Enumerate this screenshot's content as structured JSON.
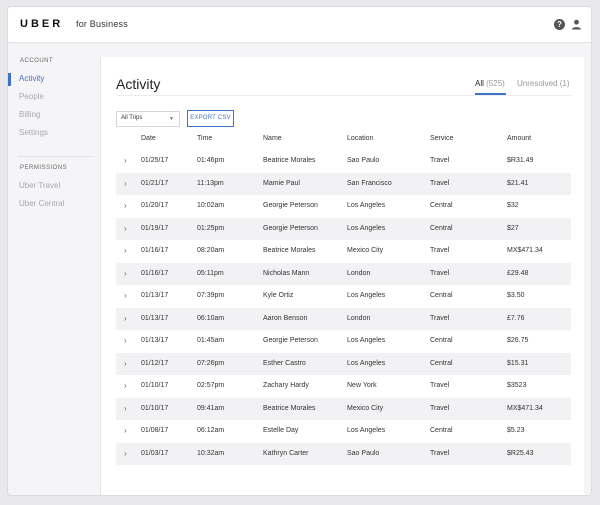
{
  "header": {
    "logo": "UBER",
    "logo_suffix": "for Business",
    "help_icon": "?",
    "icons": [
      "help-icon",
      "user-icon"
    ]
  },
  "sidebar": {
    "account_heading": "ACCOUNT",
    "account_items": [
      {
        "label": "Activity",
        "active": true
      },
      {
        "label": "People",
        "active": false
      },
      {
        "label": "Billing",
        "active": false
      },
      {
        "label": "Settings",
        "active": false
      }
    ],
    "permissions_heading": "PERMISSIONS",
    "permissions_items": [
      {
        "label": "Uber Travel"
      },
      {
        "label": "Uber Central"
      }
    ]
  },
  "main": {
    "title": "Activity",
    "tabs": [
      {
        "label": "All",
        "count": "(525)",
        "active": true
      },
      {
        "label": "Unresolved",
        "count": "(1)",
        "active": false
      }
    ],
    "filter": {
      "selected": "All Trips"
    },
    "export_label": "EXPORT CSV"
  },
  "table": {
    "columns": [
      "Date",
      "Time",
      "Name",
      "Location",
      "Service",
      "Amount"
    ],
    "rows": [
      {
        "date": "01/25/17",
        "time": "01:46pm",
        "name": "Beatrice Morales",
        "location": "Sao Paulo",
        "service": "Travel",
        "amount": "$R31.49"
      },
      {
        "date": "01/21/17",
        "time": "11:13pm",
        "name": "Mamie Paul",
        "location": "San Francisco",
        "service": "Travel",
        "amount": "$21.41"
      },
      {
        "date": "01/20/17",
        "time": "10:02am",
        "name": "Georgie Peterson",
        "location": "Los Angeles",
        "service": "Central",
        "amount": "$32"
      },
      {
        "date": "01/19/17",
        "time": "01:25pm",
        "name": "Georgie Peterson",
        "location": "Los Angeles",
        "service": "Central",
        "amount": "$27"
      },
      {
        "date": "01/16/17",
        "time": "08:20am",
        "name": "Beatrice Morales",
        "location": "Mexico City",
        "service": "Travel",
        "amount": "MX$471.34"
      },
      {
        "date": "01/16/17",
        "time": "05:11pm",
        "name": "Nicholas Mann",
        "location": "London",
        "service": "Travel",
        "amount": "£29.48"
      },
      {
        "date": "01/13/17",
        "time": "07:39pm",
        "name": "Kyle Ortiz",
        "location": "Los Angeles",
        "service": "Central",
        "amount": "$3.50"
      },
      {
        "date": "01/13/17",
        "time": "06:10am",
        "name": "Aaron Benson",
        "location": "London",
        "service": "Travel",
        "amount": "£7.76"
      },
      {
        "date": "01/13/17",
        "time": "01:45am",
        "name": "Georgie Peterson",
        "location": "Los Angeles",
        "service": "Central",
        "amount": "$26.75"
      },
      {
        "date": "01/12/17",
        "time": "07:26pm",
        "name": "Esther Castro",
        "location": "Los Angeles",
        "service": "Central",
        "amount": "$15.31"
      },
      {
        "date": "01/10/17",
        "time": "02:57pm",
        "name": "Zachary Hardy",
        "location": "New York",
        "service": "Travel",
        "amount": "$3523"
      },
      {
        "date": "01/10/17",
        "time": "09:41am",
        "name": "Beatrice Morales",
        "location": "Mexico City",
        "service": "Travel",
        "amount": "MX$471.34"
      },
      {
        "date": "01/08/17",
        "time": "06:12am",
        "name": "Estelle Day",
        "location": "Los Angeles",
        "service": "Central",
        "amount": "$5.23"
      },
      {
        "date": "01/03/17",
        "time": "10:32am",
        "name": "Kathryn Carter",
        "location": "Sao Paulo",
        "service": "Travel",
        "amount": "$R25.43"
      }
    ]
  },
  "colors": {
    "accent": "#3f73c9",
    "row_shade": "#f2f2f4",
    "muted": "#a9a9ae"
  }
}
